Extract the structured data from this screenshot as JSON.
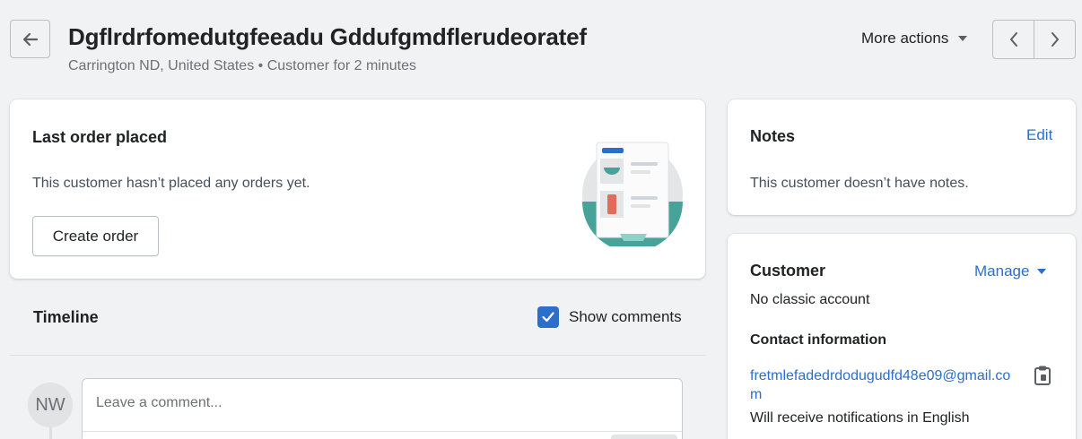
{
  "header": {
    "title": "Dgflrdrfomedutgfeeadu Gddufgmdflerudeoratef",
    "subtitle": "Carrington ND, United States • Customer for 2 minutes",
    "more_actions_label": "More actions"
  },
  "last_order": {
    "title": "Last order placed",
    "empty_text": "This customer hasn’t placed any orders yet.",
    "create_order_label": "Create order"
  },
  "timeline": {
    "title": "Timeline",
    "show_comments_label": "Show comments",
    "show_comments_checked": true,
    "avatar_initials": "NW",
    "comment_placeholder": "Leave a comment..."
  },
  "notes": {
    "title": "Notes",
    "edit_label": "Edit",
    "empty_text": "This customer doesn’t have notes."
  },
  "customer": {
    "title": "Customer",
    "manage_label": "Manage",
    "account_status": "No classic account",
    "contact_title": "Contact information",
    "email": "fretmlefadedrdodugudfd48e09@gmail.com",
    "notification_language": "Will receive notifications in English"
  },
  "colors": {
    "accent": "#2c6ecb",
    "background": "#f1f2f4",
    "card": "#ffffff",
    "teal": "#47a39a"
  },
  "icons": {
    "back": "arrow-left-icon",
    "more_actions": "caret-down-icon",
    "prev": "chevron-left-icon",
    "next": "chevron-right-icon",
    "checkbox": "checkmark-icon",
    "copy": "clipboard-icon"
  }
}
